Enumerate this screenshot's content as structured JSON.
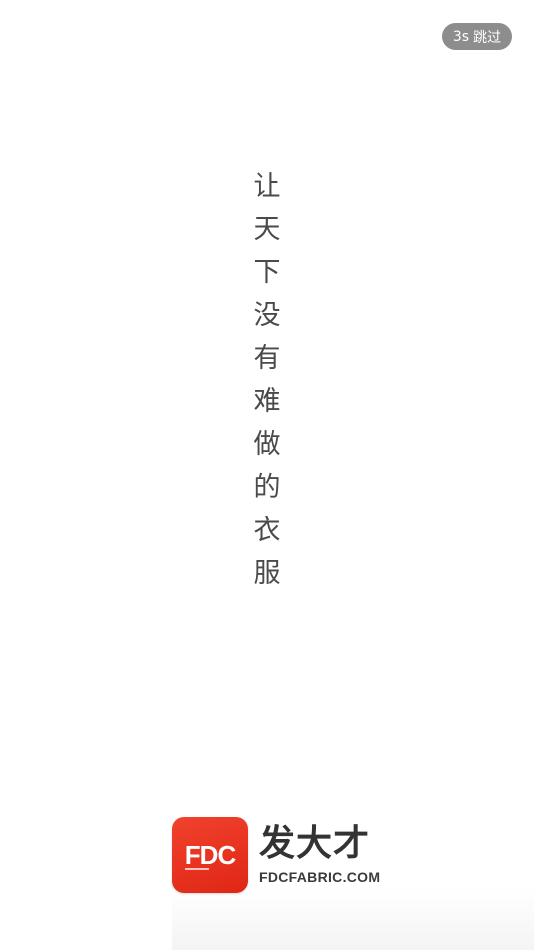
{
  "skip": {
    "countdown": "3s",
    "label": "跳过"
  },
  "slogan": {
    "chars": [
      "让",
      "天",
      "下",
      "没",
      "有",
      "难",
      "做",
      "的",
      "衣",
      "服"
    ]
  },
  "brand": {
    "logo_text": "FDC",
    "name": "发大才",
    "url": "FDCFABRIC.COM"
  },
  "colors": {
    "logo_red": "#e8321f",
    "skip_bg": "#8d8d8d",
    "slogan_text": "#4a4a4a"
  }
}
